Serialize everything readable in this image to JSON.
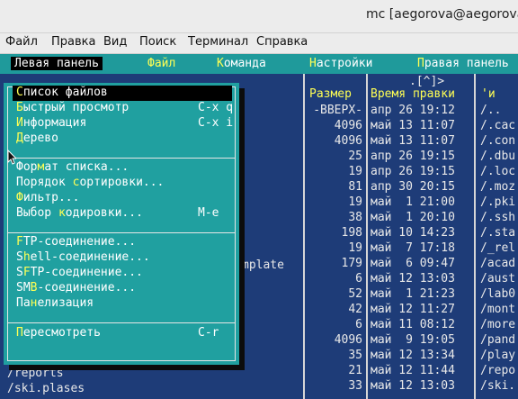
{
  "window": {
    "title": "mc [aegorova@aegorova.lo"
  },
  "app_menu": [
    "Файл",
    "Правка",
    "Вид",
    "Поиск",
    "Терминал",
    "Справка"
  ],
  "mc_menu": {
    "left_panel": "Левая панель",
    "file": "Файл",
    "command": "Команда",
    "settings": "Настройки",
    "right_panel": "Правая панель"
  },
  "panel": {
    "top_indicator": ".[^]>",
    "headers": {
      "size": "Размер",
      "mtime": "Время правки",
      "name": "'и"
    },
    "rows": [
      {
        "size": "-ВВЕРХ-",
        "mtime": "апр 26 19:12",
        "name": "/.."
      },
      {
        "size": "4096",
        "mtime": "май 13 11:07",
        "name": "/.cac"
      },
      {
        "size": "4096",
        "mtime": "май 13 11:07",
        "name": "/.con"
      },
      {
        "size": "25",
        "mtime": "апр 26 19:15",
        "name": "/.dbu"
      },
      {
        "size": "19",
        "mtime": "апр 26 19:15",
        "name": "/.loc"
      },
      {
        "size": "81",
        "mtime": "апр 30 20:15",
        "name": "/.moz"
      },
      {
        "size": "19",
        "mtime": "май  1 21:00",
        "name": "/.pki"
      },
      {
        "size": "38",
        "mtime": "май  1 20:10",
        "name": "/.ssh"
      },
      {
        "size": "198",
        "mtime": "май 10 14:23",
        "name": "/.sta"
      },
      {
        "size": "19",
        "mtime": "май  7 17:18",
        "name": "/_rel"
      },
      {
        "size": "179",
        "mtime": "май  6 09:47",
        "name": "/acad"
      },
      {
        "size": "6",
        "mtime": "май 12 13:03",
        "name": "/aust"
      },
      {
        "size": "52",
        "mtime": "май  1 21:23",
        "name": "/lab0"
      },
      {
        "size": "42",
        "mtime": "май 12 11:27",
        "name": "/mont"
      },
      {
        "size": "6",
        "mtime": "май 11 08:12",
        "name": "/more"
      },
      {
        "size": "4096",
        "mtime": "май  9 19:05",
        "name": "/pand"
      },
      {
        "size": "35",
        "mtime": "май 12 13:34",
        "name": "/play"
      },
      {
        "size": "21",
        "mtime": "май 12 11:44",
        "name": "/repo"
      },
      {
        "size": "33",
        "mtime": "май 12 13:03",
        "name": "/ski."
      }
    ],
    "left_visible": [
      "mplate",
      "/reports",
      "/ski.plases"
    ]
  },
  "dropdown": {
    "items": [
      {
        "pre": "",
        "hk": "С",
        "post": "писок файлов",
        "shortcut": "",
        "selected": true
      },
      {
        "pre": "",
        "hk": "Б",
        "post": "ыстрый просмотр",
        "shortcut": "C-x q"
      },
      {
        "pre": "",
        "hk": "И",
        "post": "нформация",
        "shortcut": "C-x i"
      },
      {
        "pre": "",
        "hk": "Д",
        "post": "ерево",
        "shortcut": ""
      },
      {
        "pre": "Фор",
        "hk": "м",
        "post": "ат списка...",
        "shortcut": ""
      },
      {
        "pre": "Порядок ",
        "hk": "с",
        "post": "ортировки...",
        "shortcut": ""
      },
      {
        "pre": "",
        "hk": "Ф",
        "post": "ильтр...",
        "shortcut": ""
      },
      {
        "pre": "Выбор ",
        "hk": "к",
        "post": "одировки...",
        "shortcut": "M-e"
      },
      {
        "pre": "",
        "hk": "F",
        "post": "TP-соединение...",
        "shortcut": ""
      },
      {
        "pre": "S",
        "hk": "h",
        "post": "ell-соединение...",
        "shortcut": ""
      },
      {
        "pre": "S",
        "hk": "F",
        "post": "TP-соединение...",
        "shortcut": ""
      },
      {
        "pre": "SM",
        "hk": "B",
        "post": "-соединение...",
        "shortcut": ""
      },
      {
        "pre": "Па",
        "hk": "н",
        "post": "елизация",
        "shortcut": ""
      },
      {
        "pre": "",
        "hk": "П",
        "post": "ересмотреть",
        "shortcut": "C-r"
      }
    ]
  },
  "colors": {
    "panel_bg": "#1e3c78",
    "menu_bg": "#1f9a9b",
    "hotkey": "#ffff54"
  },
  "icons": {
    "cursor": "mouse-pointer-icon"
  }
}
